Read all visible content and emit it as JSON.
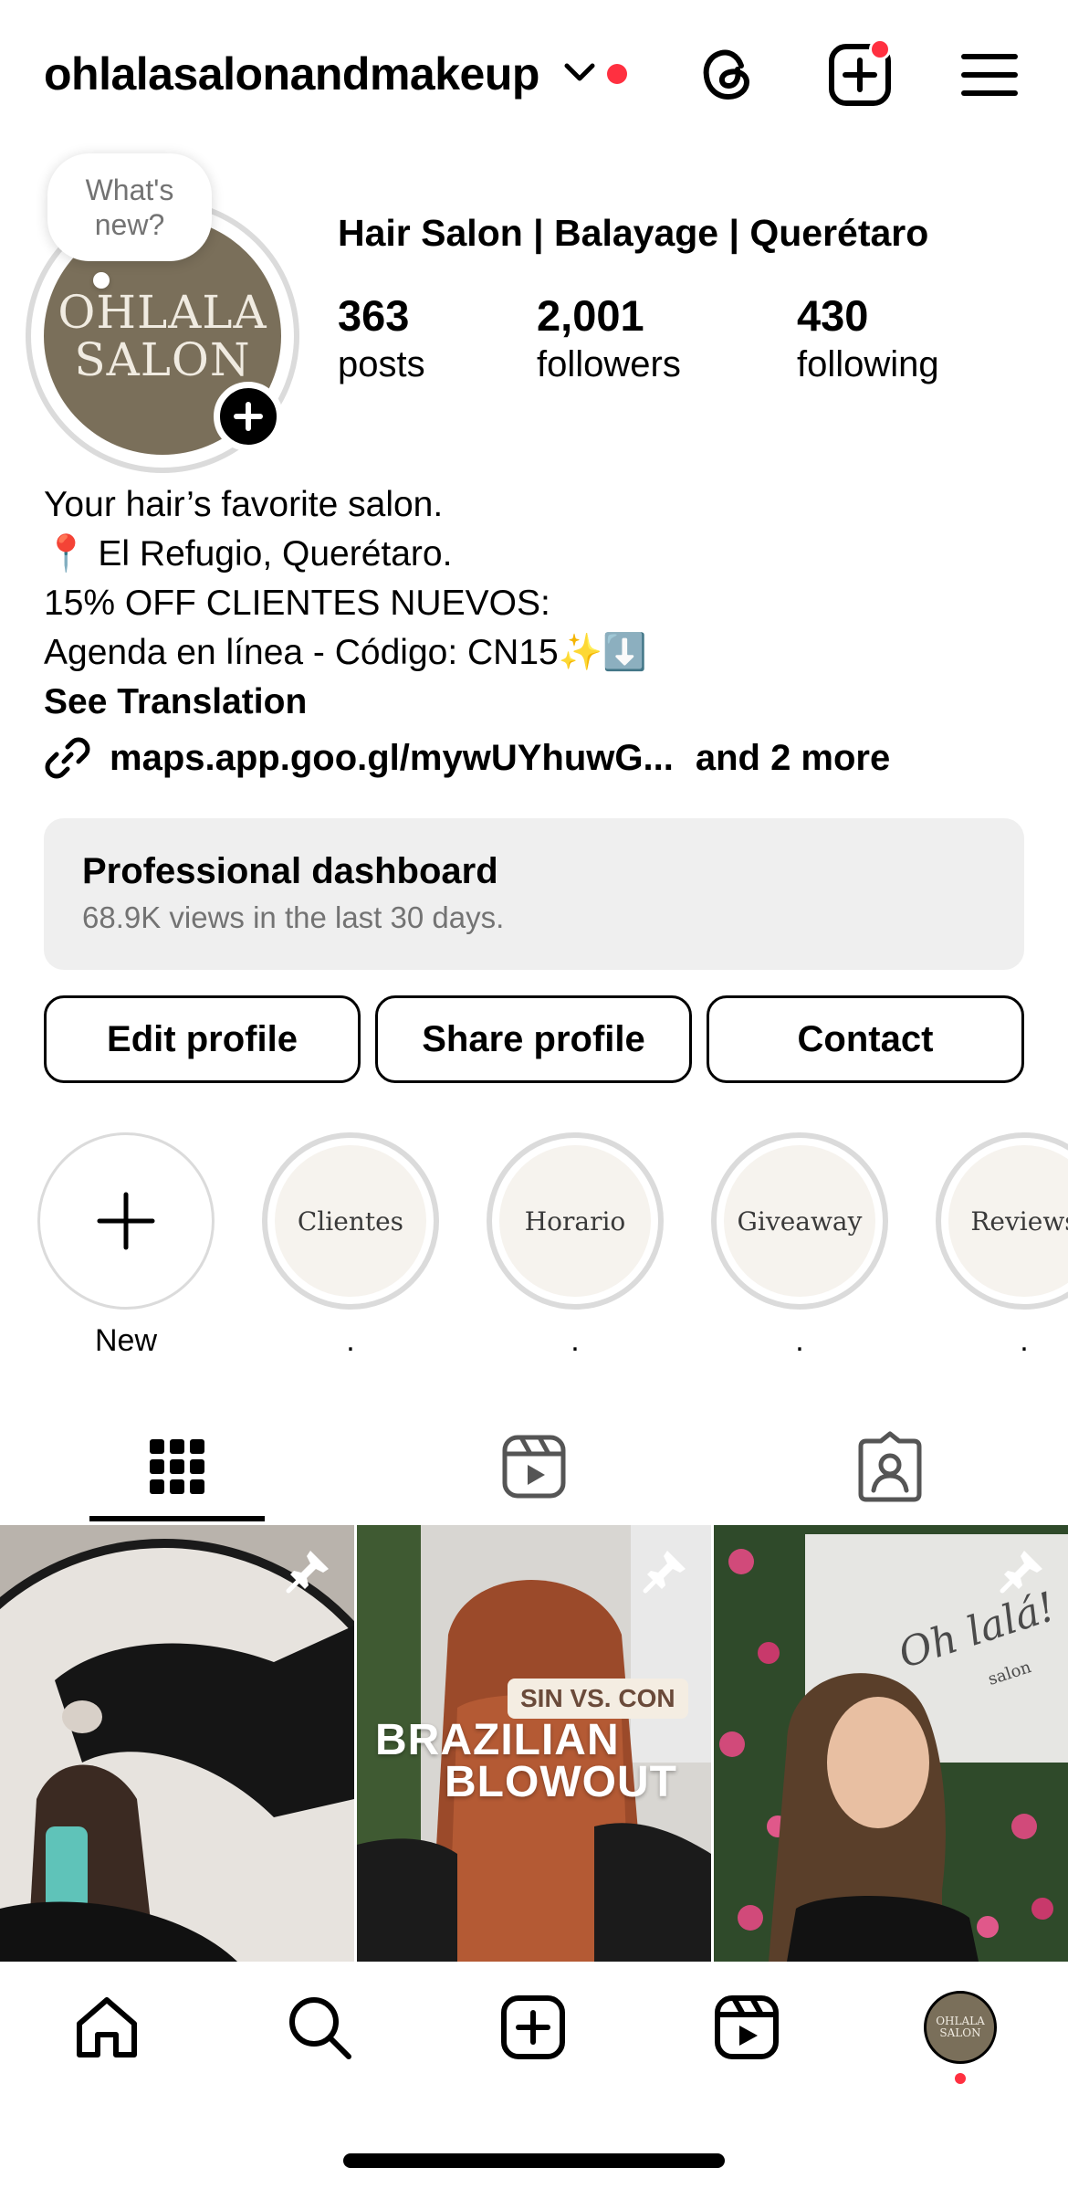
{
  "header": {
    "username": "ohlalasalonandmakeup"
  },
  "profile": {
    "avatar_text_line1": "OHLALA",
    "avatar_text_line2": "SALON",
    "note_line1": "What's",
    "note_line2": "new?",
    "category": "Hair Salon | Balayage | Querétaro",
    "stats": [
      {
        "value": "363",
        "label": "posts"
      },
      {
        "value": "2,001",
        "label": "followers"
      },
      {
        "value": "430",
        "label": "following"
      }
    ]
  },
  "bio": {
    "line1": "Your hair’s favorite salon.",
    "line2": "📍 El Refugio, Querétaro.",
    "line3": "15% OFF CLIENTES NUEVOS:",
    "line4": "Agenda en línea - Código: CN15✨⬇️",
    "translation": "See Translation",
    "link": "maps.app.goo.gl/mywUYhuwG...",
    "link_more": "and 2 more"
  },
  "dashboard": {
    "title": "Professional dashboard",
    "subtitle": "68.9K views in the last 30 days."
  },
  "buttons": {
    "edit": "Edit profile",
    "share": "Share profile",
    "contact": "Contact"
  },
  "highlights": [
    {
      "title": "",
      "caption": "New"
    },
    {
      "title": "Clientes",
      "caption": "."
    },
    {
      "title": "Horario",
      "caption": "."
    },
    {
      "title": "Giveaway",
      "caption": "."
    },
    {
      "title": "Reviews",
      "caption": "."
    }
  ],
  "posts": [
    {
      "overlay_tag": "",
      "overlay_title_1": "",
      "overlay_title_2": ""
    },
    {
      "overlay_tag": "SIN VS. CON",
      "overlay_title_1": "BRAZILIAN",
      "overlay_title_2": "BLOWOUT"
    },
    {
      "overlay_tag": "",
      "overlay_title_1": "Oh lalá!",
      "overlay_title_2": "salon"
    }
  ],
  "nav_avatar": {
    "line1": "OHLALA",
    "line2": "SALON"
  },
  "colors": {
    "accent_red": "#ff3040",
    "avatar_bg": "#7a6f5a",
    "dashboard_bg": "#efefef",
    "muted_text": "#737373"
  }
}
